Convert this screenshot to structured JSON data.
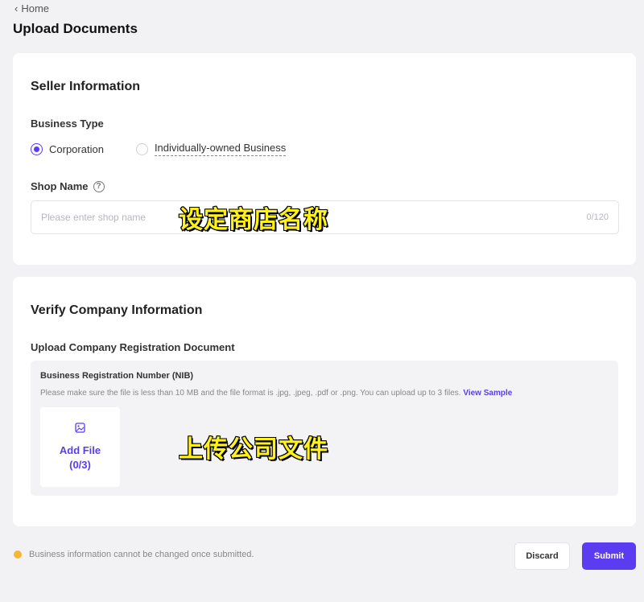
{
  "breadcrumb": {
    "label": "Home"
  },
  "page": {
    "title": "Upload Documents"
  },
  "seller": {
    "title": "Seller Information",
    "business_type_label": "Business Type",
    "options": [
      {
        "label": "Corporation",
        "checked": true
      },
      {
        "label": "Individually-owned Business",
        "checked": false
      }
    ],
    "shop_name_label": "Shop Name",
    "shop_name_placeholder": "Please enter shop name",
    "shop_name_value": "",
    "char_count": "0/120",
    "overlay_text": "设定商店名称"
  },
  "verify": {
    "title": "Verify Company Information",
    "upload_label": "Upload Company Registration Document",
    "nib_title": "Business Registration Number (NIB)",
    "nib_desc": "Please make sure the file is less than 10 MB and the file format is .jpg, .jpeg, .pdf or .png. You can upload up to 3 files.",
    "view_sample": "View Sample",
    "add_file_label": "Add File",
    "add_file_count": "(0/3)",
    "overlay_text": "上传公司文件"
  },
  "footer": {
    "note": "Business information cannot be changed once submitted.",
    "discard_label": "Discard",
    "submit_label": "Submit"
  },
  "colors": {
    "accent": "#5b3cf0",
    "warning": "#f5b731",
    "background": "#f2f2f4",
    "overlay_text": "#fff21a"
  },
  "icons": [
    "chevron-left-icon",
    "help-circle-icon",
    "image-icon",
    "warning-dot-icon"
  ]
}
